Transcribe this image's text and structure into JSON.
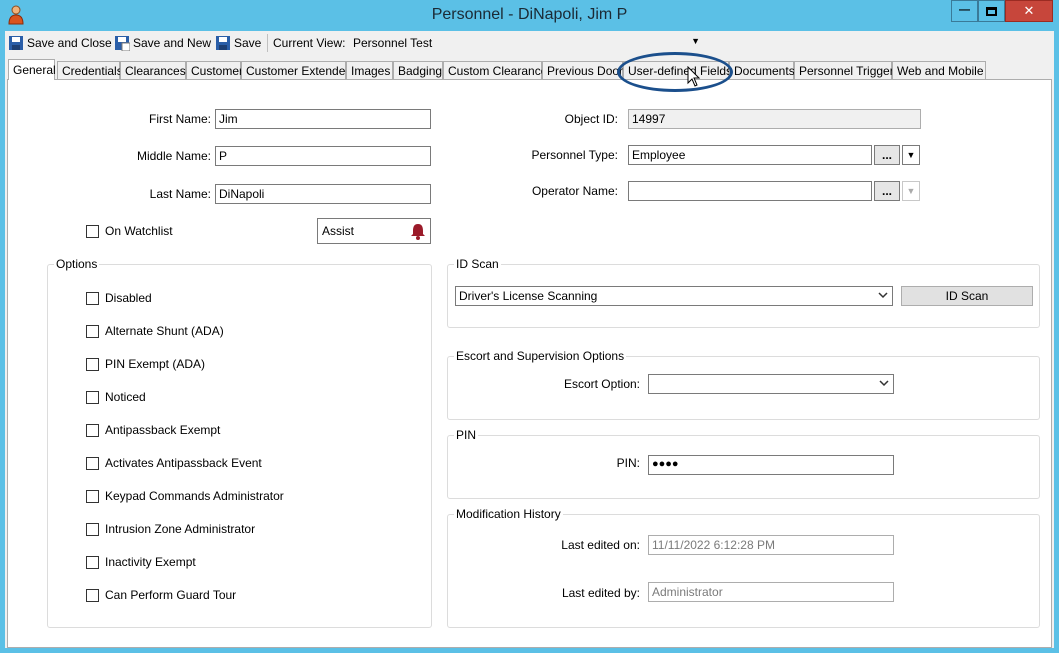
{
  "window": {
    "title": "Personnel  -  DiNapoli, Jim P",
    "minimize_glyph": "—",
    "close_glyph": "✕"
  },
  "toolbar": {
    "save_close_label": "Save and Close",
    "save_new_label": "Save and New",
    "save_label": "Save",
    "current_view_label": "Current View:",
    "current_view_value": "Personnel Test"
  },
  "tabs": [
    {
      "label": "General"
    },
    {
      "label": "Credentials"
    },
    {
      "label": "Clearances"
    },
    {
      "label": "Customer"
    },
    {
      "label": "Customer Extended"
    },
    {
      "label": "Images"
    },
    {
      "label": "Badging"
    },
    {
      "label": "Custom Clearance"
    },
    {
      "label": "Previous Doors"
    },
    {
      "label": "User-defined Fields"
    },
    {
      "label": "Documents"
    },
    {
      "label": "Personnel Triggers"
    },
    {
      "label": "Web and Mobile"
    }
  ],
  "general": {
    "first_name_label": "First Name:",
    "first_name_value": "Jim",
    "middle_name_label": "Middle Name:",
    "middle_name_value": "P",
    "last_name_label": "Last Name:",
    "last_name_value": "DiNapoli",
    "watchlist_label": "On Watchlist",
    "assist_label": "Assist",
    "object_id_label": "Object ID:",
    "object_id_value": "14997",
    "personnel_type_label": "Personnel Type:",
    "personnel_type_value": "Employee",
    "operator_name_label": "Operator Name:",
    "operator_name_value": "",
    "ellipsis": "..."
  },
  "options": {
    "title": "Options",
    "items": [
      "Disabled",
      "Alternate Shunt (ADA)",
      "PIN Exempt (ADA)",
      "Noticed",
      "Antipassback Exempt",
      "Activates Antipassback Event",
      "Keypad Commands Administrator",
      "Intrusion Zone Administrator",
      "Inactivity Exempt",
      "Can Perform Guard Tour"
    ]
  },
  "id_scan": {
    "title": "ID Scan",
    "selected": "Driver's License Scanning",
    "button_label": "ID Scan"
  },
  "escort": {
    "title": "Escort and Supervision Options",
    "option_label": "Escort Option:",
    "option_value": ""
  },
  "pin": {
    "title": "PIN",
    "label": "PIN:",
    "value": "●●●●"
  },
  "history": {
    "title": "Modification History",
    "edited_on_label": "Last edited on:",
    "edited_on_value": "11/11/2022 6:12:28 PM",
    "edited_by_label": "Last edited by:",
    "edited_by_value": "Administrator"
  },
  "colors": {
    "titlebar": "#5bc0e6",
    "close_button": "#c7463b",
    "highlight_ring": "#1b4f8c",
    "bell": "#9b1b2a"
  }
}
